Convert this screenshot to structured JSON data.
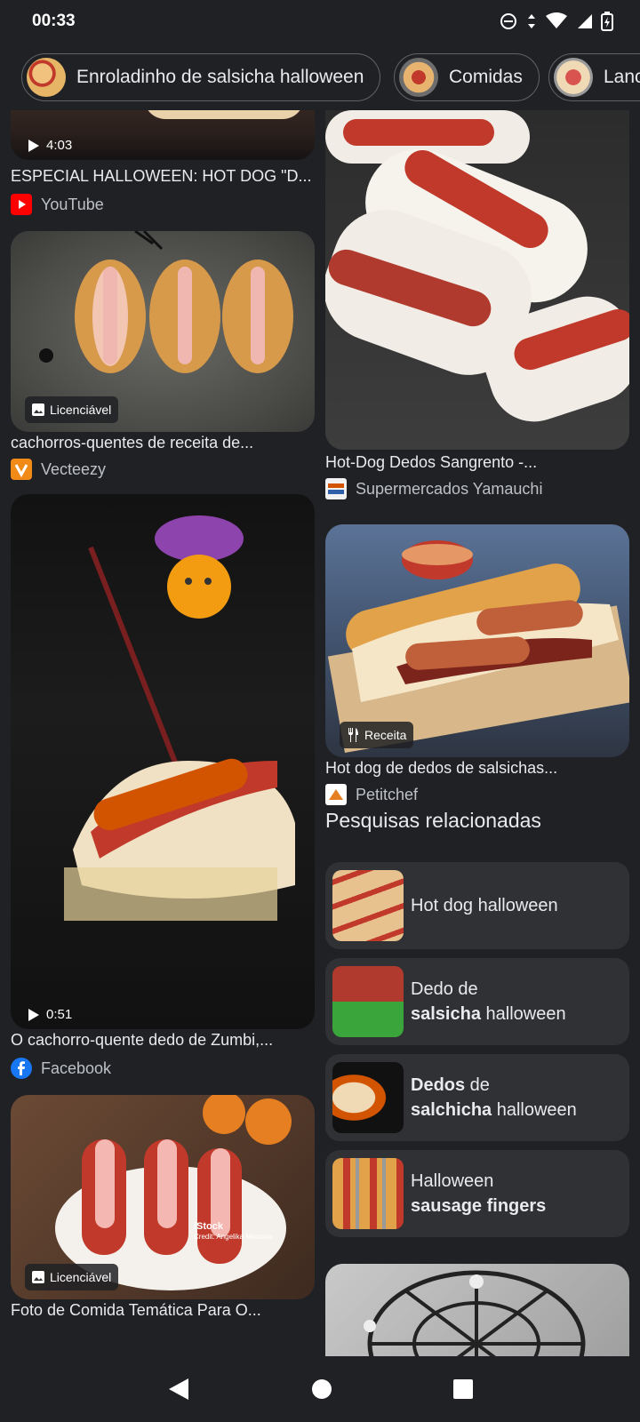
{
  "status_bar": {
    "time": "00:33"
  },
  "chips": [
    {
      "label": "Enroladinho de salsicha halloween"
    },
    {
      "label": "Comidas"
    },
    {
      "label": "Lanc"
    }
  ],
  "results": {
    "r1": {
      "duration": "4:03",
      "title": "ESPECIAL HALLOWEEN: HOT DOG \"D...",
      "source": "YouTube"
    },
    "r2": {
      "badge": "Licenciável",
      "title": "cachorros-quentes de receita de...",
      "source": "Vecteezy"
    },
    "r3": {
      "duration": "0:51",
      "title": "O cachorro-quente dedo de Zumbi,...",
      "source": "Facebook"
    },
    "r4": {
      "badge": "Licenciável",
      "title": "Foto de Comida Temática Para O...",
      "watermark": "iStock",
      "credit": "Credit: Angelika Mostova"
    },
    "r5": {
      "title": "Hot-Dog Dedos Sangrento -...",
      "source": "Supermercados Yamauchi"
    },
    "r6": {
      "badge": "Receita",
      "title": "Hot dog de dedos de salsichas...",
      "source": "Petitchef"
    }
  },
  "related": {
    "heading": "Pesquisas relacionadas",
    "items": [
      {
        "line1": "Hot dog halloween"
      },
      {
        "plain1": "Dedo de",
        "bold2": "salsicha",
        "plain2": " halloween"
      },
      {
        "bold1": "Dedos",
        "plain1": " de",
        "bold2": "salchicha",
        "plain2": " halloween"
      },
      {
        "plain1": "Halloween",
        "bold2": "sausage fingers"
      }
    ]
  },
  "colors": {
    "background": "#202124",
    "card": "#303134",
    "text": "#e8eaed",
    "muted": "#bdc1c6"
  }
}
